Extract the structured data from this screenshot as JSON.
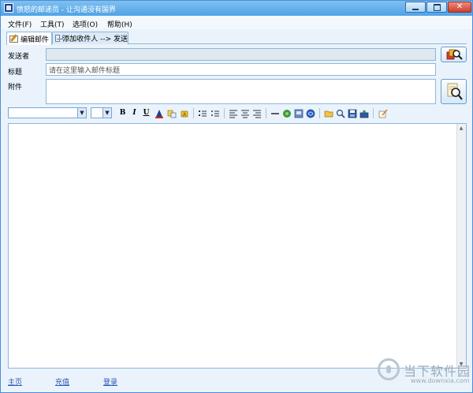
{
  "window": {
    "title": "愤怒的邮递员 - 让沟通没有国界",
    "controls": {
      "minimize": "minimize",
      "maximize": "maximize",
      "close": "close"
    }
  },
  "menu": [
    {
      "label": "文件(F)"
    },
    {
      "label": "工具(T)"
    },
    {
      "label": "选项(O)"
    },
    {
      "label": "帮助(H)"
    }
  ],
  "tabs": [
    {
      "label": "编辑邮件",
      "icon": "note-pencil-icon",
      "active": true
    },
    {
      "label": "添加收件人 --> 发送",
      "icon": "envelope-icon",
      "active": false
    }
  ],
  "form": {
    "sender_label": "发送者",
    "sender_value": "",
    "subject_label": "标题",
    "subject_placeholder": "请在这里输入邮件标题",
    "attachment_label": "附件",
    "attachment_value": ""
  },
  "toolbar": {
    "font_family_value": "",
    "font_size_value": "",
    "bold": "B",
    "italic": "I",
    "underline": "U",
    "icons": [
      "text-color-icon",
      "background-color-icon",
      "clear-format-icon",
      "ordered-list-icon",
      "unordered-list-icon",
      "align-left-icon",
      "align-center-icon",
      "align-right-icon",
      "horizontal-rule-icon",
      "insert-image-icon",
      "insert-table-icon",
      "insert-link-icon",
      "open-file-icon",
      "preview-icon",
      "save-icon",
      "upload-icon",
      "edit-source-icon"
    ]
  },
  "editor": {
    "content": ""
  },
  "footer": {
    "links": [
      {
        "label": "主页"
      },
      {
        "label": "充值"
      },
      {
        "label": "登录"
      }
    ]
  },
  "watermark": {
    "name": "当下软件园",
    "url": "www.downxia.com"
  },
  "colors": {
    "titlebar": "#4fa3e6",
    "window_bg": "#eaf3fb",
    "border": "#8fb6dd",
    "link": "#2a56b8"
  }
}
